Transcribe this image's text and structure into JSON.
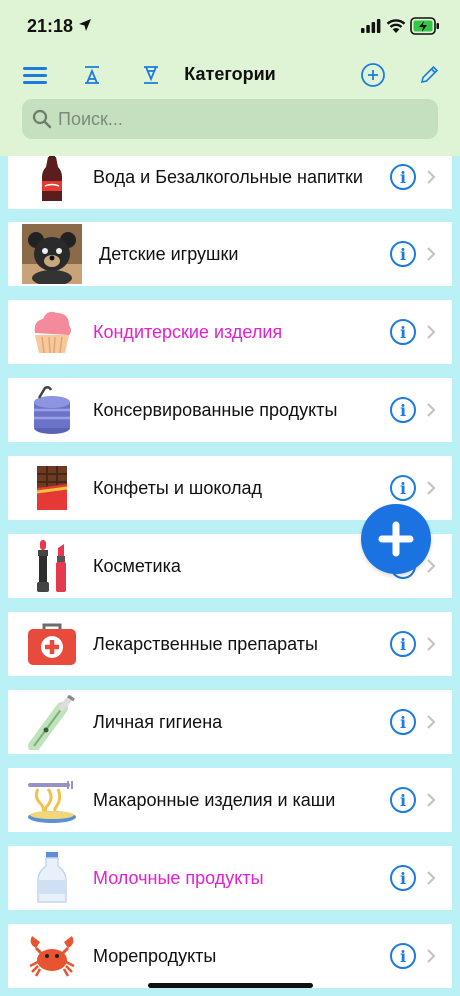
{
  "status": {
    "time": "21:18"
  },
  "nav": {
    "title": "Категории"
  },
  "search": {
    "placeholder": "Поиск..."
  },
  "categories": [
    {
      "label": "Вода и Безалкогольные напитки",
      "icon": "soda-bottle-icon",
      "highlight": false
    },
    {
      "label": "Детские игрушки",
      "icon": "teddy-bear-photo",
      "highlight": false
    },
    {
      "label": "Кондитерские изделия",
      "icon": "cupcake-icon",
      "highlight": true
    },
    {
      "label": "Консервированные продукты",
      "icon": "tin-can-icon",
      "highlight": false
    },
    {
      "label": "Конфеты и шоколад",
      "icon": "chocolate-bar-icon",
      "highlight": false
    },
    {
      "label": "Косметика",
      "icon": "lipstick-icon",
      "highlight": false
    },
    {
      "label": "Лекарственные препараты",
      "icon": "first-aid-kit-icon",
      "highlight": false
    },
    {
      "label": "Личная гигиена",
      "icon": "toothbrush-icon",
      "highlight": false
    },
    {
      "label": "Макаронные изделия и каши",
      "icon": "pasta-icon",
      "highlight": false
    },
    {
      "label": "Молочные продукты",
      "icon": "milk-bottle-icon",
      "highlight": true
    },
    {
      "label": "Морепродукты",
      "icon": "crab-icon",
      "highlight": false
    }
  ],
  "colors": {
    "accent": "#1c7be0",
    "highlight_text": "#e21fd4",
    "topbar_bg": "#dff4d4",
    "list_bg": "#b9f1f6"
  }
}
